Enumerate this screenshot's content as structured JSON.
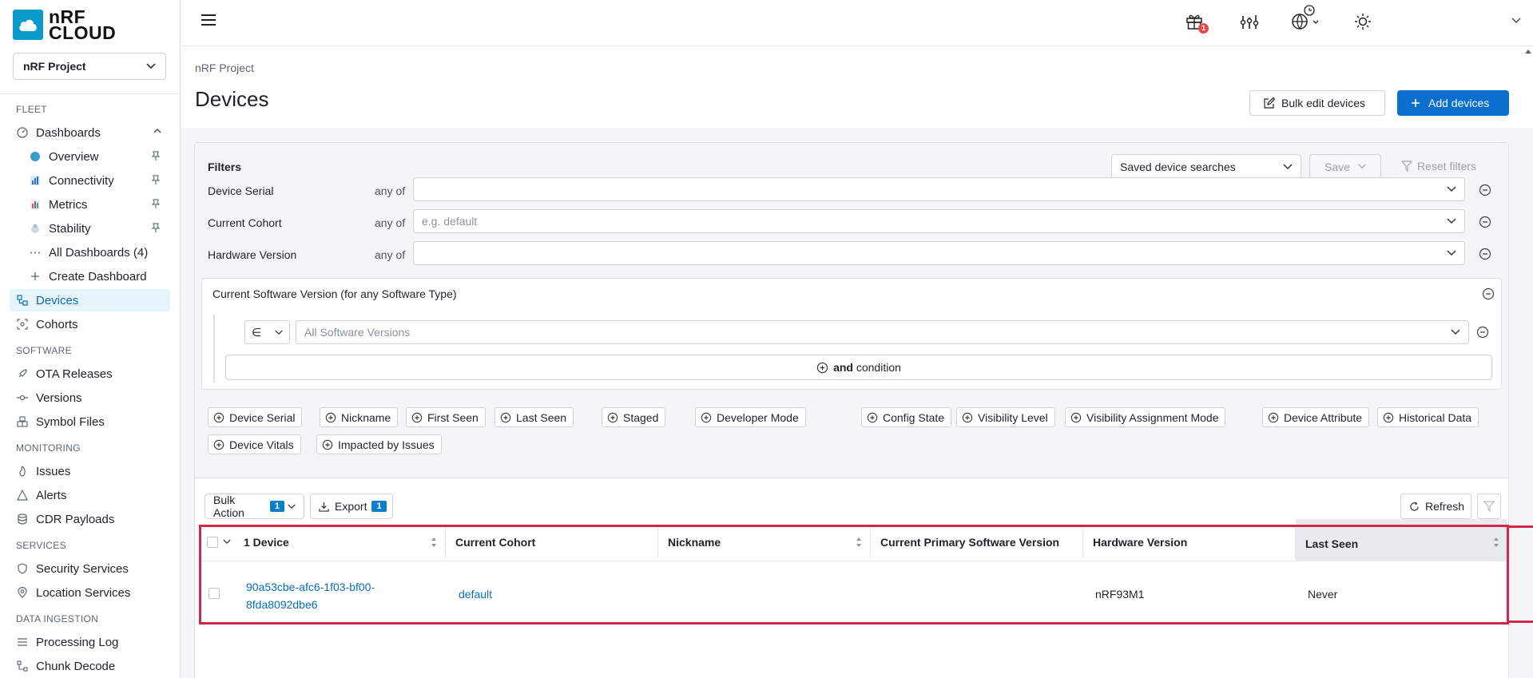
{
  "brand": {
    "line1": "nRF",
    "line2": "CLOUD",
    "color": "#0a99c9"
  },
  "project_selector": {
    "value": "nRF Project"
  },
  "sidebar": {
    "sections": {
      "fleet": "FLEET",
      "software": "SOFTWARE",
      "monitoring": "MONITORING",
      "services": "SERVICES",
      "data_ingestion": "DATA INGESTION"
    },
    "items": {
      "dashboards": "Dashboards",
      "overview": "Overview",
      "connectivity": "Connectivity",
      "metrics": "Metrics",
      "stability": "Stability",
      "all_dashboards": "All Dashboards (4)",
      "create_dashboard": "Create Dashboard",
      "devices": "Devices",
      "cohorts": "Cohorts",
      "ota_releases": "OTA Releases",
      "versions": "Versions",
      "symbol_files": "Symbol Files",
      "issues": "Issues",
      "alerts": "Alerts",
      "cdr_payloads": "CDR Payloads",
      "security_services": "Security Services",
      "location_services": "Location Services",
      "processing_log": "Processing Log",
      "chunk_decode": "Chunk Decode"
    }
  },
  "topbar": {
    "gift_badge": "1",
    "icons": [
      "menu-icon",
      "gift-icon",
      "chart-icon",
      "globe-clock-icon",
      "sun-icon",
      "chevron-down-icon"
    ]
  },
  "page": {
    "breadcrumb": "nRF Project",
    "title": "Devices",
    "bulk_edit_label": "Bulk edit devices",
    "add_devices_label": "Add devices"
  },
  "filters": {
    "title": "Filters",
    "saved_searches": "Saved device searches",
    "save": "Save",
    "reset": "Reset filters",
    "rows": [
      {
        "label": "Device Serial",
        "op": "any of",
        "placeholder": ""
      },
      {
        "label": "Current Cohort",
        "op": "any of",
        "placeholder": "e.g. default"
      },
      {
        "label": "Hardware Version",
        "op": "any of",
        "placeholder": ""
      }
    ],
    "software": {
      "title": "Current Software Version (for any Software Type)",
      "operator": "∈",
      "placeholder": "All Software Versions",
      "and_bold": "and",
      "and_rest": " condition"
    },
    "chips": [
      "Device Serial",
      "Nickname",
      "First Seen",
      "Last Seen",
      "Staged",
      "Developer Mode",
      "Config State",
      "Visibility Level",
      "Visibility Assignment Mode",
      "Device Attribute",
      "Historical Data",
      "Device Vitals",
      "Impacted by Issues"
    ]
  },
  "actions": {
    "bulk_action": "Bulk Action",
    "bulk_count": "1",
    "export": "Export",
    "export_count": "1",
    "refresh": "Refresh"
  },
  "table": {
    "headers": {
      "device": "1 Device",
      "cohort": "Current Cohort",
      "nickname": "Nickname",
      "software": "Current Primary Software Version",
      "hardware": "Hardware Version",
      "last_seen": "Last Seen"
    },
    "rows": [
      {
        "serial_line1": "90a53cbe-afc6-1f03-bf00-",
        "serial_line2": "8fda8092dbe6",
        "cohort": "default",
        "nickname": "",
        "software": "",
        "hardware": "nRF93M1",
        "last_seen": "Never"
      }
    ]
  },
  "colors": {
    "accent": "#0b6fd0",
    "highlight_border": "#d0284a",
    "active_nav_bg": "#e8f4fb"
  }
}
